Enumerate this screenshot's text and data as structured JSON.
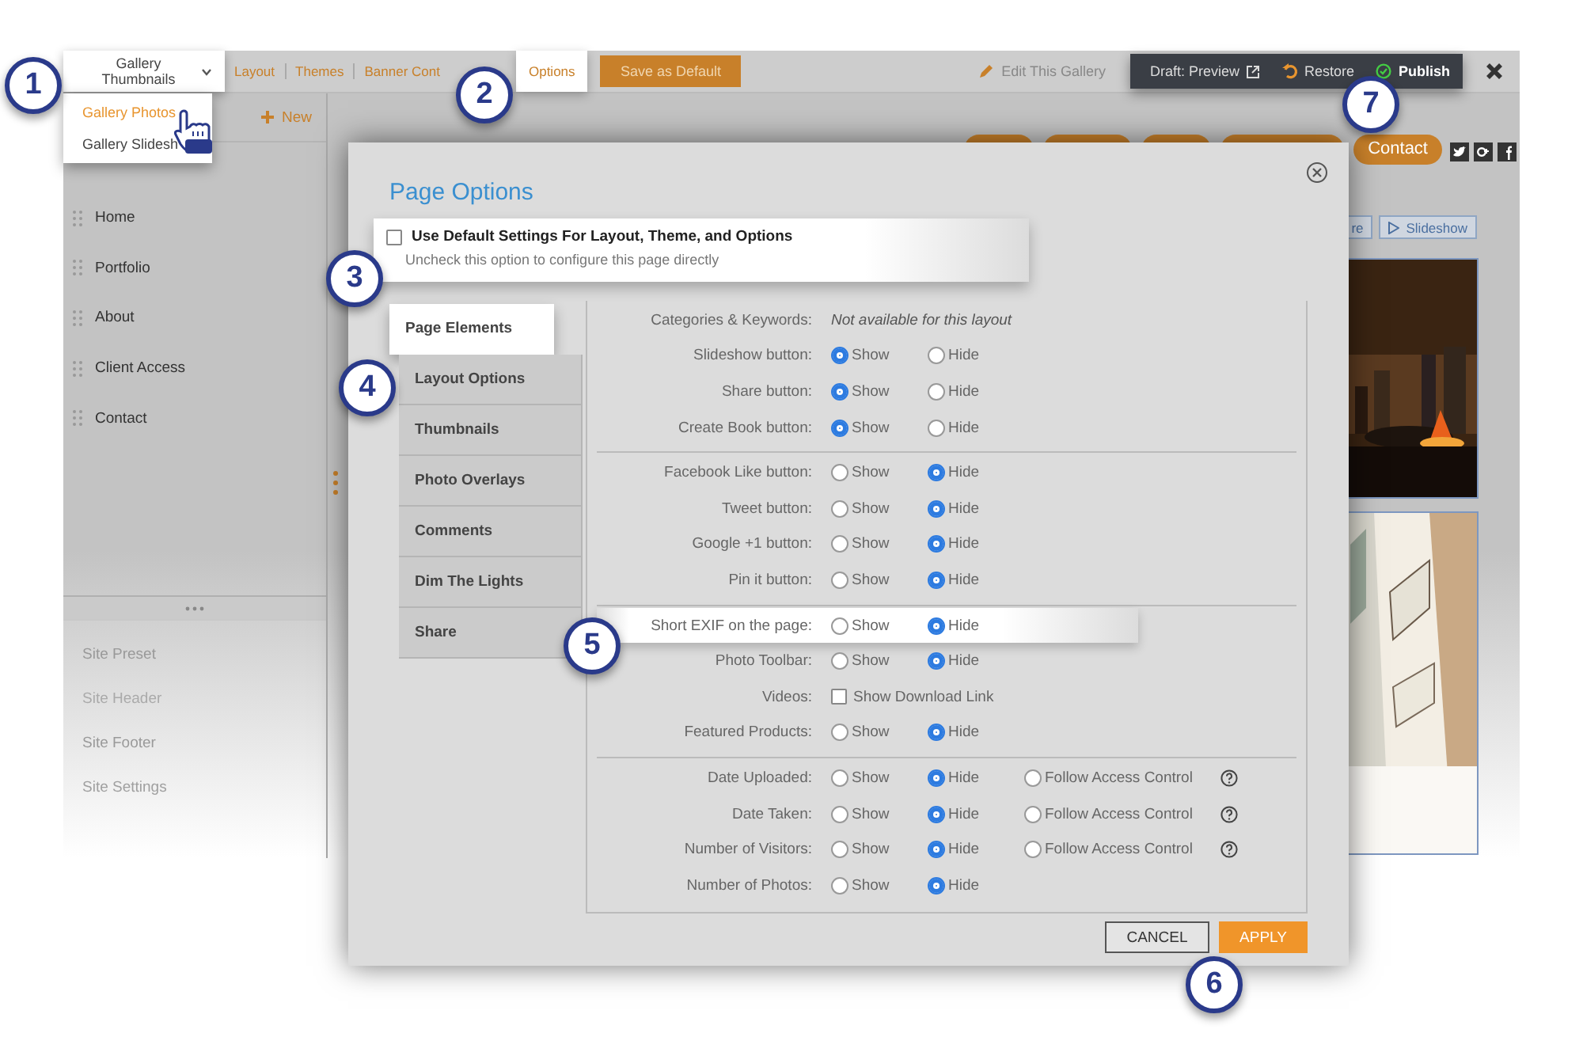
{
  "toolbar": {
    "page_menu": {
      "label": "Gallery Thumbnails",
      "highlighted": true
    },
    "links": [
      {
        "label": "Layout",
        "highlighted": false
      },
      {
        "label": "Themes",
        "highlighted": false
      },
      {
        "label": "Banner Cont",
        "highlighted": false
      },
      {
        "label": "Options",
        "highlighted": true
      }
    ],
    "save_button": "Save as Default",
    "edit_link": "Edit This Gallery",
    "draft_preview": "Draft: Preview",
    "restore": "Restore",
    "publish": "Publish"
  },
  "page_menu_dropdown": [
    {
      "label": "Gallery Photos",
      "selected": true
    },
    {
      "label": "Gallery Slidesh",
      "selected": false
    }
  ],
  "sidebar": {
    "new_button": "New",
    "pages": [
      "Home",
      "Portfolio",
      "About",
      "Client Access",
      "Contact"
    ],
    "sections": [
      "Site Preset",
      "Site Header",
      "Site Footer",
      "Site Settings"
    ]
  },
  "site_preview": {
    "nav_pills": [
      {
        "kind": "covered"
      },
      {
        "kind": "covered"
      },
      {
        "kind": "covered"
      },
      {
        "kind": "covered"
      },
      {
        "kind": "label",
        "label": "Contact"
      }
    ],
    "gallery_buttons": [
      {
        "kind": "plain",
        "label": "re"
      },
      {
        "kind": "play",
        "label": "Slideshow"
      }
    ]
  },
  "dialog": {
    "title": "Page Options",
    "use_default": {
      "label": "Use Default Settings For Layout, Theme, and Options",
      "hint": "Uncheck this option to configure this page directly",
      "checked": false,
      "highlighted": true
    },
    "tabs": [
      {
        "label": "Page Elements",
        "selected": true
      },
      {
        "label": "Layout Options",
        "selected": false
      },
      {
        "label": "Thumbnails",
        "selected": false
      },
      {
        "label": "Photo Overlays",
        "selected": false
      },
      {
        "label": "Comments",
        "selected": false
      },
      {
        "label": "Dim The Lights",
        "selected": false
      },
      {
        "label": "Share",
        "selected": false
      }
    ],
    "sections": [
      {
        "rows": [
          {
            "label": "Categories & Keywords:",
            "kind": "note",
            "note": "Not available for this layout",
            "highlighted": false
          },
          {
            "label": "Slideshow button:",
            "kind": "radio",
            "highlighted": false,
            "options": [
              {
                "label": "Show",
                "selected": true
              },
              {
                "label": "Hide",
                "selected": false
              }
            ]
          },
          {
            "label": "Share button:",
            "kind": "radio",
            "highlighted": false,
            "options": [
              {
                "label": "Show",
                "selected": true
              },
              {
                "label": "Hide",
                "selected": false
              }
            ]
          },
          {
            "label": "Create Book button:",
            "kind": "radio",
            "highlighted": false,
            "options": [
              {
                "label": "Show",
                "selected": true
              },
              {
                "label": "Hide",
                "selected": false
              }
            ]
          }
        ]
      },
      {
        "rows": [
          {
            "label": "Facebook Like button:",
            "kind": "radio",
            "highlighted": false,
            "options": [
              {
                "label": "Show",
                "selected": false
              },
              {
                "label": "Hide",
                "selected": true
              }
            ]
          },
          {
            "label": "Tweet button:",
            "kind": "radio",
            "highlighted": false,
            "options": [
              {
                "label": "Show",
                "selected": false
              },
              {
                "label": "Hide",
                "selected": true
              }
            ]
          },
          {
            "label": "Google +1 button:",
            "kind": "radio",
            "highlighted": false,
            "options": [
              {
                "label": "Show",
                "selected": false
              },
              {
                "label": "Hide",
                "selected": true
              }
            ]
          },
          {
            "label": "Pin it button:",
            "kind": "radio",
            "highlighted": false,
            "options": [
              {
                "label": "Show",
                "selected": false
              },
              {
                "label": "Hide",
                "selected": true
              }
            ]
          }
        ]
      },
      {
        "rows": [
          {
            "label": "Short EXIF on the page:",
            "kind": "radio",
            "highlighted": true,
            "options": [
              {
                "label": "Show",
                "selected": false
              },
              {
                "label": "Hide",
                "selected": true
              }
            ]
          },
          {
            "label": "Photo Toolbar:",
            "kind": "radio",
            "highlighted": false,
            "options": [
              {
                "label": "Show",
                "selected": false
              },
              {
                "label": "Hide",
                "selected": true
              }
            ]
          },
          {
            "label": "Videos:",
            "kind": "checkbox",
            "highlighted": false,
            "options": [
              {
                "label": "Show Download Link",
                "checked": false
              }
            ]
          },
          {
            "label": "Featured Products:",
            "kind": "radio",
            "highlighted": false,
            "options": [
              {
                "label": "Show",
                "selected": false
              },
              {
                "label": "Hide",
                "selected": true
              }
            ]
          }
        ]
      },
      {
        "rows": [
          {
            "label": "Date Uploaded:",
            "kind": "radio",
            "highlighted": false,
            "help": true,
            "options": [
              {
                "label": "Show",
                "selected": false
              },
              {
                "label": "Hide",
                "selected": true
              },
              {
                "label": "Follow Access Control",
                "selected": false
              }
            ]
          },
          {
            "label": "Date Taken:",
            "kind": "radio",
            "highlighted": false,
            "help": true,
            "options": [
              {
                "label": "Show",
                "selected": false
              },
              {
                "label": "Hide",
                "selected": true
              },
              {
                "label": "Follow Access Control",
                "selected": false
              }
            ]
          },
          {
            "label": "Number of Visitors:",
            "kind": "radio",
            "highlighted": false,
            "help": true,
            "options": [
              {
                "label": "Show",
                "selected": false
              },
              {
                "label": "Hide",
                "selected": true
              },
              {
                "label": "Follow Access Control",
                "selected": false
              }
            ]
          },
          {
            "label": "Number of Photos:",
            "kind": "radio",
            "highlighted": false,
            "options": [
              {
                "label": "Show",
                "selected": false
              },
              {
                "label": "Hide",
                "selected": true
              }
            ]
          }
        ]
      }
    ],
    "buttons": [
      {
        "kind": "secondary",
        "label": "CANCEL"
      },
      {
        "kind": "primary",
        "label": "APPLY"
      }
    ]
  },
  "callouts": [
    "1",
    "2",
    "3",
    "4",
    "5",
    "6",
    "7"
  ]
}
